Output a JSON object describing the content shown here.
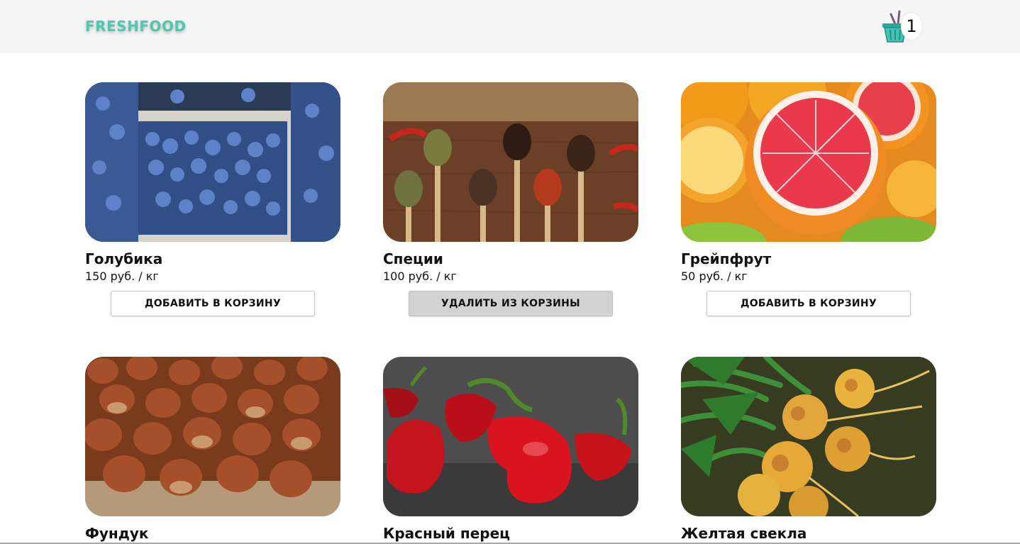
{
  "brand": {
    "name": "FRESHFOOD",
    "color": "#4dc9b0"
  },
  "cart": {
    "icon": "shopping-basket-icon",
    "count": "1"
  },
  "products": [
    {
      "title": "Голубика",
      "price": "150 руб. / кг",
      "button": "ДОБАВИТЬ В КОРЗИНУ",
      "in_cart": false,
      "image": "blueberries-photo"
    },
    {
      "title": "Специи",
      "price": "100 руб. / кг",
      "button": "УДАЛИТЬ ИЗ КОРЗИНЫ",
      "in_cart": true,
      "image": "spices-photo"
    },
    {
      "title": "Грейпфрут",
      "price": "50 руб. / кг",
      "button": "ДОБАВИТЬ В КОРЗИНУ",
      "in_cart": false,
      "image": "grapefruit-photo"
    },
    {
      "title": "Фундук",
      "image": "hazelnuts-photo"
    },
    {
      "title": "Красный перец",
      "image": "red-pepper-photo"
    },
    {
      "title": "Желтая свекла",
      "image": "yellow-beet-photo"
    }
  ]
}
